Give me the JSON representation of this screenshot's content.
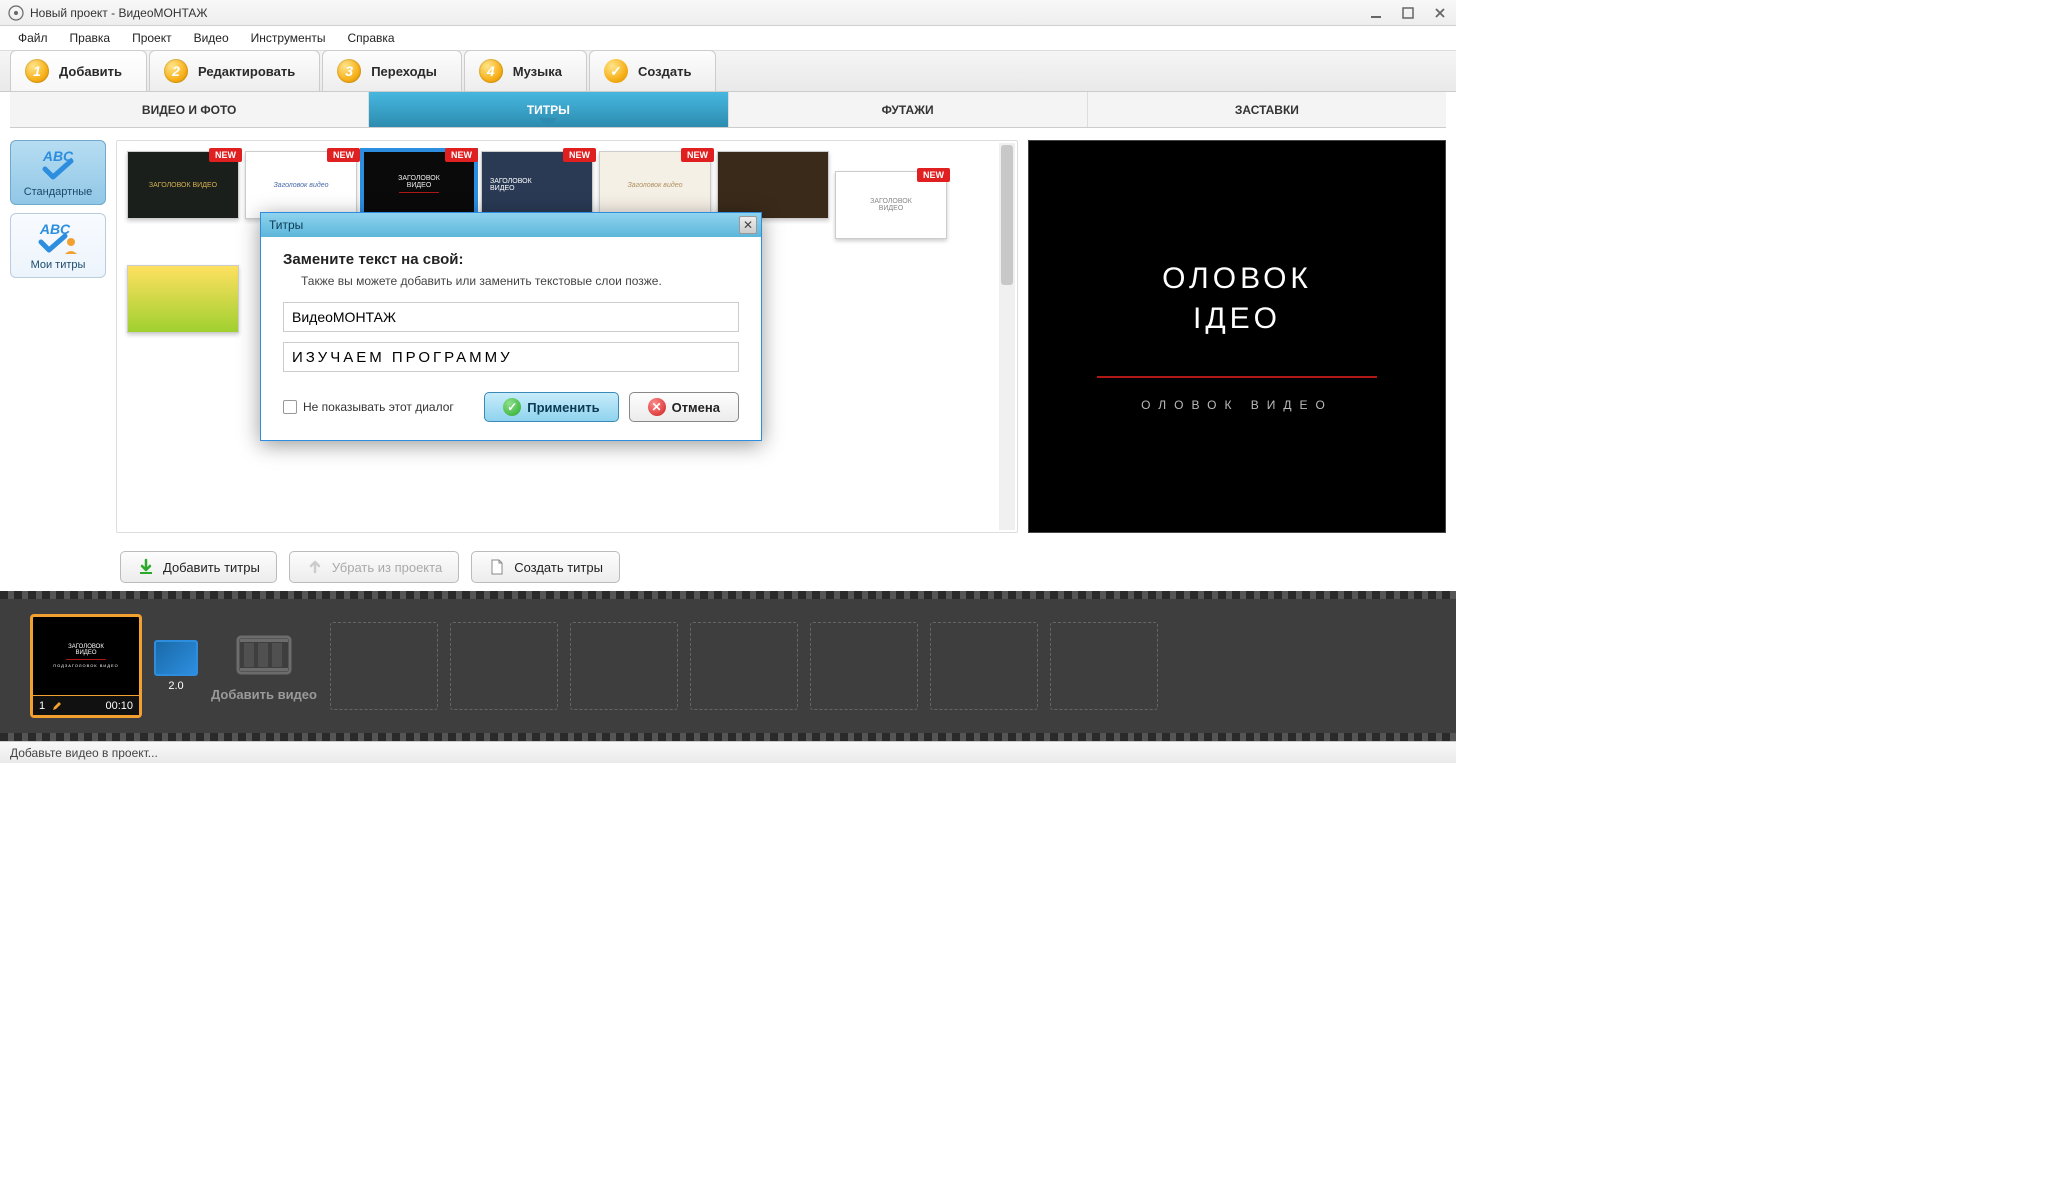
{
  "window": {
    "title": "Новый проект - ВидеоМОНТАЖ"
  },
  "menu": {
    "items": [
      "Файл",
      "Правка",
      "Проект",
      "Видео",
      "Инструменты",
      "Справка"
    ]
  },
  "steps": [
    {
      "num": "1",
      "label": "Добавить"
    },
    {
      "num": "2",
      "label": "Редактировать"
    },
    {
      "num": "3",
      "label": "Переходы"
    },
    {
      "num": "4",
      "label": "Музыка"
    },
    {
      "num": "✓",
      "label": "Создать"
    }
  ],
  "subtabs": {
    "items": [
      "ВИДЕО И ФОТО",
      "ТИТРЫ",
      "ФУТАЖИ",
      "ЗАСТАВКИ"
    ],
    "active": 1
  },
  "categories": {
    "standard": "Стандартные",
    "my": "Мои титры"
  },
  "templates": {
    "new_badge": "NEW",
    "thumb_title": "ЗАГОЛОВОК ВИДЕО",
    "thumb_alt": "ЗАГОЛОВОК\nВИДЕО",
    "thumb_script": "Заголовок видео"
  },
  "actions": {
    "add_titles": "Добавить титры",
    "remove": "Убрать из проекта",
    "create_titles": "Создать титры"
  },
  "timeline": {
    "clip_title1": "ЗАГОЛОВОК",
    "clip_title2": "ВИДЕО",
    "clip_caption": "ПОДЗАГОЛОВОК ВИДЕО",
    "clip_index": "1",
    "clip_time": "00:10",
    "trans_duration": "2.0",
    "add_video": "Добавить видео"
  },
  "preview": {
    "line1": "ОЛОВОК",
    "line2": "ІДЕО",
    "caption": "ОЛОВОК ВИДЕО"
  },
  "status": {
    "text": "Добавьте видео в проект..."
  },
  "dialog": {
    "title": "Титры",
    "heading": "Замените текст на свой:",
    "subtext": "Также вы можете добавить или заменить текстовые слои позже.",
    "field1": "ВидеоМОНТАЖ",
    "field2": "ИЗУЧАЕМ ПРОГРАММУ",
    "dont_show": "Не показывать этот диалог",
    "apply": "Применить",
    "cancel": "Отмена"
  }
}
